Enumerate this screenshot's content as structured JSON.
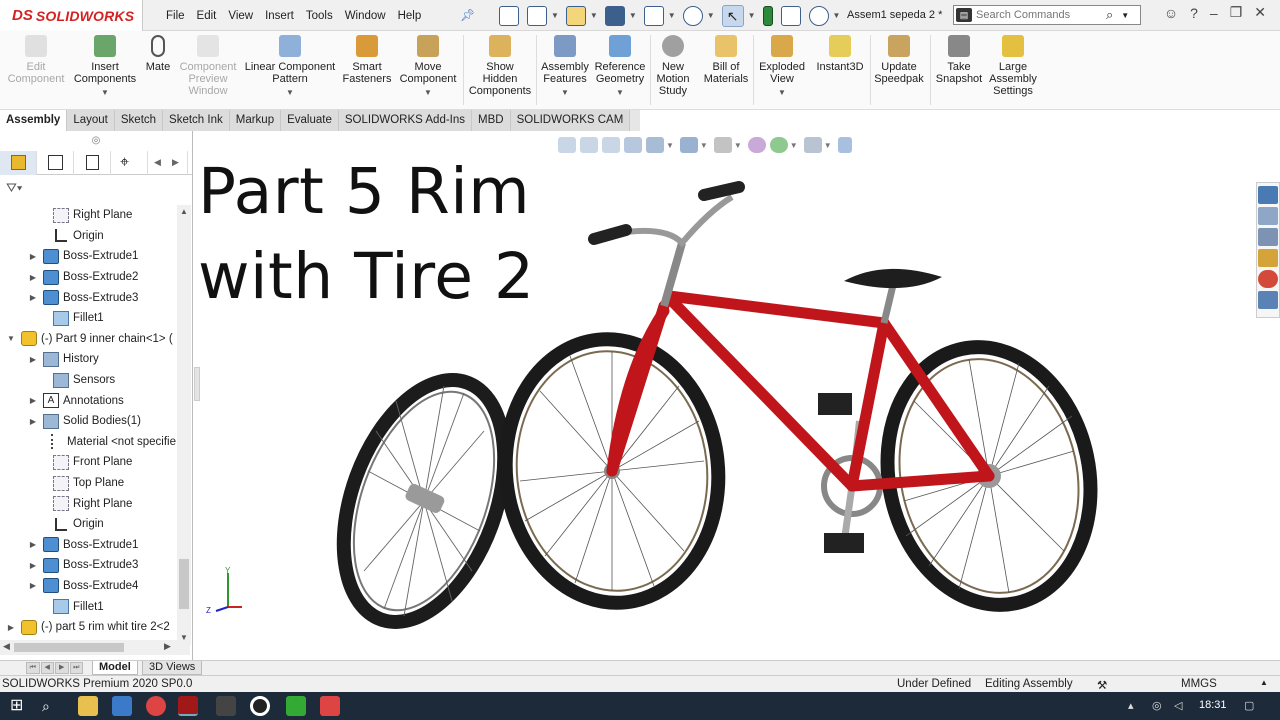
{
  "app": {
    "logo_mark": "DS",
    "logo_text": "SOLIDWORKS",
    "menu": [
      "File",
      "Edit",
      "View",
      "Insert",
      "Tools",
      "Window",
      "Help"
    ],
    "document_title": "Assem1 sepeda 2 *",
    "search_placeholder": "Search Commands"
  },
  "command_manager": [
    {
      "label_1": "Edit",
      "label_2": "Component",
      "label_3": "",
      "disabled": true
    },
    {
      "label_1": "Insert",
      "label_2": "Components",
      "label_3": "",
      "disabled": false
    },
    {
      "label_1": "Mate",
      "label_2": "",
      "label_3": "",
      "disabled": false
    },
    {
      "label_1": "Component",
      "label_2": "Preview",
      "label_3": "Window",
      "disabled": true
    },
    {
      "label_1": "Linear Component",
      "label_2": "Pattern",
      "label_3": "",
      "disabled": false
    },
    {
      "label_1": "Smart",
      "label_2": "Fasteners",
      "label_3": "",
      "disabled": false
    },
    {
      "label_1": "Move",
      "label_2": "Component",
      "label_3": "",
      "disabled": false
    },
    {
      "label_1": "Show",
      "label_2": "Hidden",
      "label_3": "Components",
      "disabled": false
    },
    {
      "label_1": "Assembly",
      "label_2": "Features",
      "label_3": "",
      "disabled": false
    },
    {
      "label_1": "Reference",
      "label_2": "Geometry",
      "label_3": "",
      "disabled": false
    },
    {
      "label_1": "New",
      "label_2": "Motion",
      "label_3": "Study",
      "disabled": false
    },
    {
      "label_1": "Bill of",
      "label_2": "Materials",
      "label_3": "",
      "disabled": false
    },
    {
      "label_1": "Exploded",
      "label_2": "View",
      "label_3": "",
      "disabled": false
    },
    {
      "label_1": "Instant3D",
      "label_2": "",
      "label_3": "",
      "disabled": false
    },
    {
      "label_1": "Update",
      "label_2": "Speedpak",
      "label_3": "",
      "disabled": false
    },
    {
      "label_1": "Take",
      "label_2": "Snapshot",
      "label_3": "",
      "disabled": false
    },
    {
      "label_1": "Large",
      "label_2": "Assembly",
      "label_3": "Settings",
      "disabled": false
    }
  ],
  "tabs": [
    "Assembly",
    "Layout",
    "Sketch",
    "Sketch Ink",
    "Markup",
    "Evaluate",
    "SOLIDWORKS Add-Ins",
    "MBD",
    "SOLIDWORKS CAM"
  ],
  "tree": [
    {
      "label": "Right Plane",
      "icon": "plane",
      "expander": ""
    },
    {
      "label": "Origin",
      "icon": "origin",
      "expander": ""
    },
    {
      "label": "Boss-Extrude1",
      "icon": "feat",
      "expander": "▶"
    },
    {
      "label": "Boss-Extrude2",
      "icon": "feat",
      "expander": "▶"
    },
    {
      "label": "Boss-Extrude3",
      "icon": "feat",
      "expander": "▶"
    },
    {
      "label": "Fillet1",
      "icon": "fillet",
      "expander": ""
    },
    {
      "label": "(-) Part 9 inner chain<1> (",
      "icon": "part",
      "expander": "▼"
    },
    {
      "label": "History",
      "icon": "fold",
      "expander": "▶"
    },
    {
      "label": "Sensors",
      "icon": "fold",
      "expander": ""
    },
    {
      "label": "Annotations",
      "icon": "anno",
      "expander": "▶"
    },
    {
      "label": "Solid Bodies(1)",
      "icon": "fold",
      "expander": "▶"
    },
    {
      "label": "Material <not specifie",
      "icon": "mat",
      "expander": ""
    },
    {
      "label": "Front Plane",
      "icon": "plane",
      "expander": ""
    },
    {
      "label": "Top Plane",
      "icon": "plane",
      "expander": ""
    },
    {
      "label": "Right Plane",
      "icon": "plane",
      "expander": ""
    },
    {
      "label": "Origin",
      "icon": "origin",
      "expander": ""
    },
    {
      "label": "Boss-Extrude1",
      "icon": "feat",
      "expander": "▶"
    },
    {
      "label": "Boss-Extrude3",
      "icon": "feat",
      "expander": "▶"
    },
    {
      "label": "Boss-Extrude4",
      "icon": "feat",
      "expander": "▶"
    },
    {
      "label": "Fillet1",
      "icon": "fillet",
      "expander": ""
    },
    {
      "label": "(-) part 5 rim whit tire 2<2",
      "icon": "part",
      "expander": "▶"
    }
  ],
  "overlay": {
    "line1": "Part 5 Rim",
    "line2": "with Tire 2"
  },
  "bottom_tabs": [
    "Model",
    "3D Views"
  ],
  "status": {
    "product": "SOLIDWORKS Premium 2020 SP0.0",
    "state": "Under Defined",
    "mode": "Editing Assembly",
    "units": "MMGS"
  },
  "taskbar": {
    "time": "18:31"
  },
  "colors": {
    "frame": "#c0161b",
    "accent": "#3a6fc7",
    "brand": "#d42222"
  }
}
